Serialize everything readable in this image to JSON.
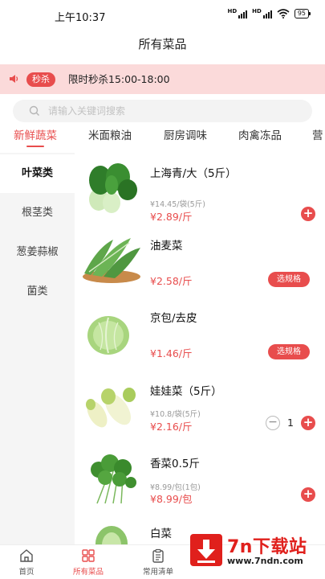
{
  "status_bar": {
    "time": "上午10:37",
    "battery": "95",
    "network_labels": [
      "HD",
      "HD"
    ]
  },
  "header": {
    "title": "所有菜品"
  },
  "flash_sale": {
    "badge": "秒杀",
    "text": "限时秒杀15:00-18:00",
    "icon": "speaker-icon"
  },
  "search": {
    "placeholder": "请输入关键词搜索",
    "icon": "search-icon"
  },
  "tabs": [
    {
      "label": "新鲜蔬菜",
      "active": true
    },
    {
      "label": "米面粮油",
      "active": false
    },
    {
      "label": "厨房调味",
      "active": false
    },
    {
      "label": "肉禽冻品",
      "active": false
    },
    {
      "label": "营",
      "active": false
    }
  ],
  "sidebar": {
    "items": [
      {
        "label": "叶菜类",
        "active": true
      },
      {
        "label": "根茎类",
        "active": false
      },
      {
        "label": "葱姜蒜椒",
        "active": false
      },
      {
        "label": "菌类",
        "active": false
      }
    ]
  },
  "products": [
    {
      "name": "上海青/大（5斤）",
      "sub": "¥14.45/袋(5斤)",
      "price": "¥2.89/斤",
      "action": "add"
    },
    {
      "name": "油麦菜",
      "sub": "",
      "price": "¥2.58/斤",
      "action": "spec",
      "spec_label": "选规格"
    },
    {
      "name": "京包/去皮",
      "sub": "",
      "price": "¥1.46/斤",
      "action": "spec",
      "spec_label": "选规格"
    },
    {
      "name": "娃娃菜（5斤）",
      "sub": "¥10.8/袋(5斤)",
      "price": "¥2.16/斤",
      "action": "stepper",
      "qty": "1"
    },
    {
      "name": "香菜0.5斤",
      "sub": "¥8.99/包(1包)",
      "price": "¥8.99/包",
      "action": "add"
    },
    {
      "name": "白菜",
      "sub": "",
      "price": "",
      "action": "none"
    }
  ],
  "bottom_nav": [
    {
      "label": "首页",
      "icon": "home-icon",
      "active": false
    },
    {
      "label": "所有菜品",
      "icon": "grid-icon",
      "active": true
    },
    {
      "label": "常用清单",
      "icon": "clipboard-icon",
      "active": false
    }
  ],
  "watermark": {
    "title": "7n下载站",
    "url": "www.7ndn.com"
  },
  "colors": {
    "accent": "#e84d4d",
    "flash_bg": "#fbdada",
    "sidebar_bg": "#f5f5f5"
  }
}
